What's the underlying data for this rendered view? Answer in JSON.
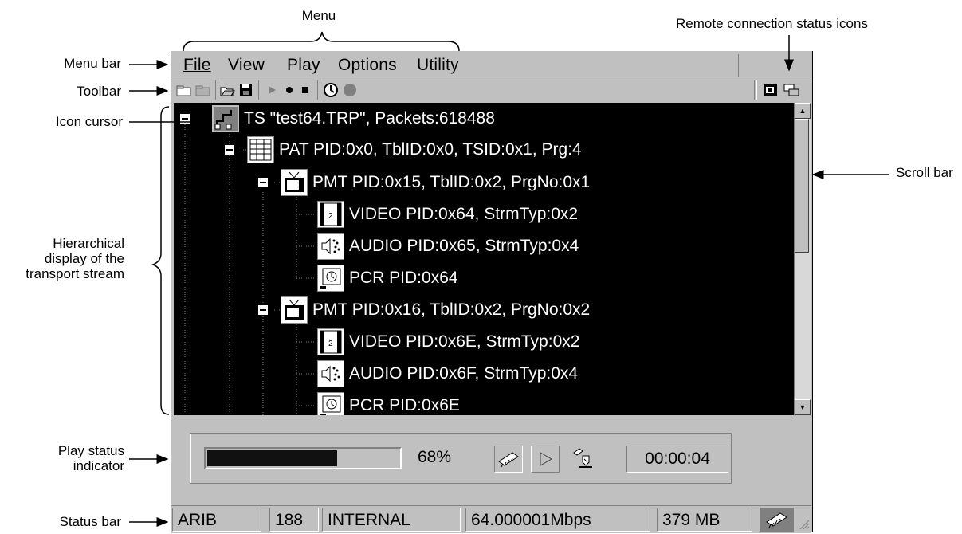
{
  "annotations": {
    "menu": "Menu",
    "remote_status_icons": "Remote connection status icons",
    "menu_bar": "Menu bar",
    "toolbar": "Toolbar",
    "icon_cursor": "Icon cursor",
    "scroll_bar": "Scroll bar",
    "hierarchical_display": [
      "Hierarchical",
      "display of the",
      "transport stream"
    ],
    "play_status": [
      "Play status",
      "indicator"
    ],
    "status_bar": "Status bar"
  },
  "menubar": {
    "items": [
      {
        "label": "File",
        "icon": "none"
      },
      {
        "label": "View"
      },
      {
        "label": "Play"
      },
      {
        "label": "Options"
      },
      {
        "label": "Utility"
      }
    ]
  },
  "toolbar": {
    "buttons": [
      "new-icon",
      "open-folder-icon",
      "open-file-icon",
      "save-icon",
      "play-icon",
      "record-icon",
      "stop-icon",
      "timer-icon",
      "status-light-icon"
    ],
    "remote_icons": [
      "remote-camera-icon",
      "remote-network-icon"
    ]
  },
  "tree": {
    "nodes": [
      {
        "label": "TS \"test64.TRP\", Packets:618488",
        "icon": "ts-icon"
      },
      {
        "label": "PAT PID:0x0, TblID:0x0, TSID:0x1, Prg:4",
        "icon": "pat-table-icon"
      },
      {
        "label": "PMT PID:0x15, TblID:0x2, PrgNo:0x1",
        "icon": "tv-icon"
      },
      {
        "label": "VIDEO PID:0x64, StrmTyp:0x2",
        "icon": "film-icon"
      },
      {
        "label": "AUDIO PID:0x65, StrmTyp:0x4",
        "icon": "speaker-icon"
      },
      {
        "label": "PCR PID:0x64",
        "icon": "clock-icon"
      },
      {
        "label": "PMT PID:0x16, TblID:0x2, PrgNo:0x2",
        "icon": "tv-icon"
      },
      {
        "label": "VIDEO PID:0x6E, StrmTyp:0x2",
        "icon": "film-icon"
      },
      {
        "label": "AUDIO PID:0x6F, StrmTyp:0x4",
        "icon": "speaker-icon"
      },
      {
        "label": "PCR PID:0x6E",
        "icon": "clock-icon"
      }
    ]
  },
  "play_status": {
    "progress_text": "68%",
    "progress_fraction": 0.68,
    "elapsed": "00:00:04"
  },
  "statusbar": {
    "standard": "ARIB",
    "packet_size": "188",
    "clock": "INTERNAL",
    "rate": "64.000001Mbps",
    "size": "379 MB"
  }
}
